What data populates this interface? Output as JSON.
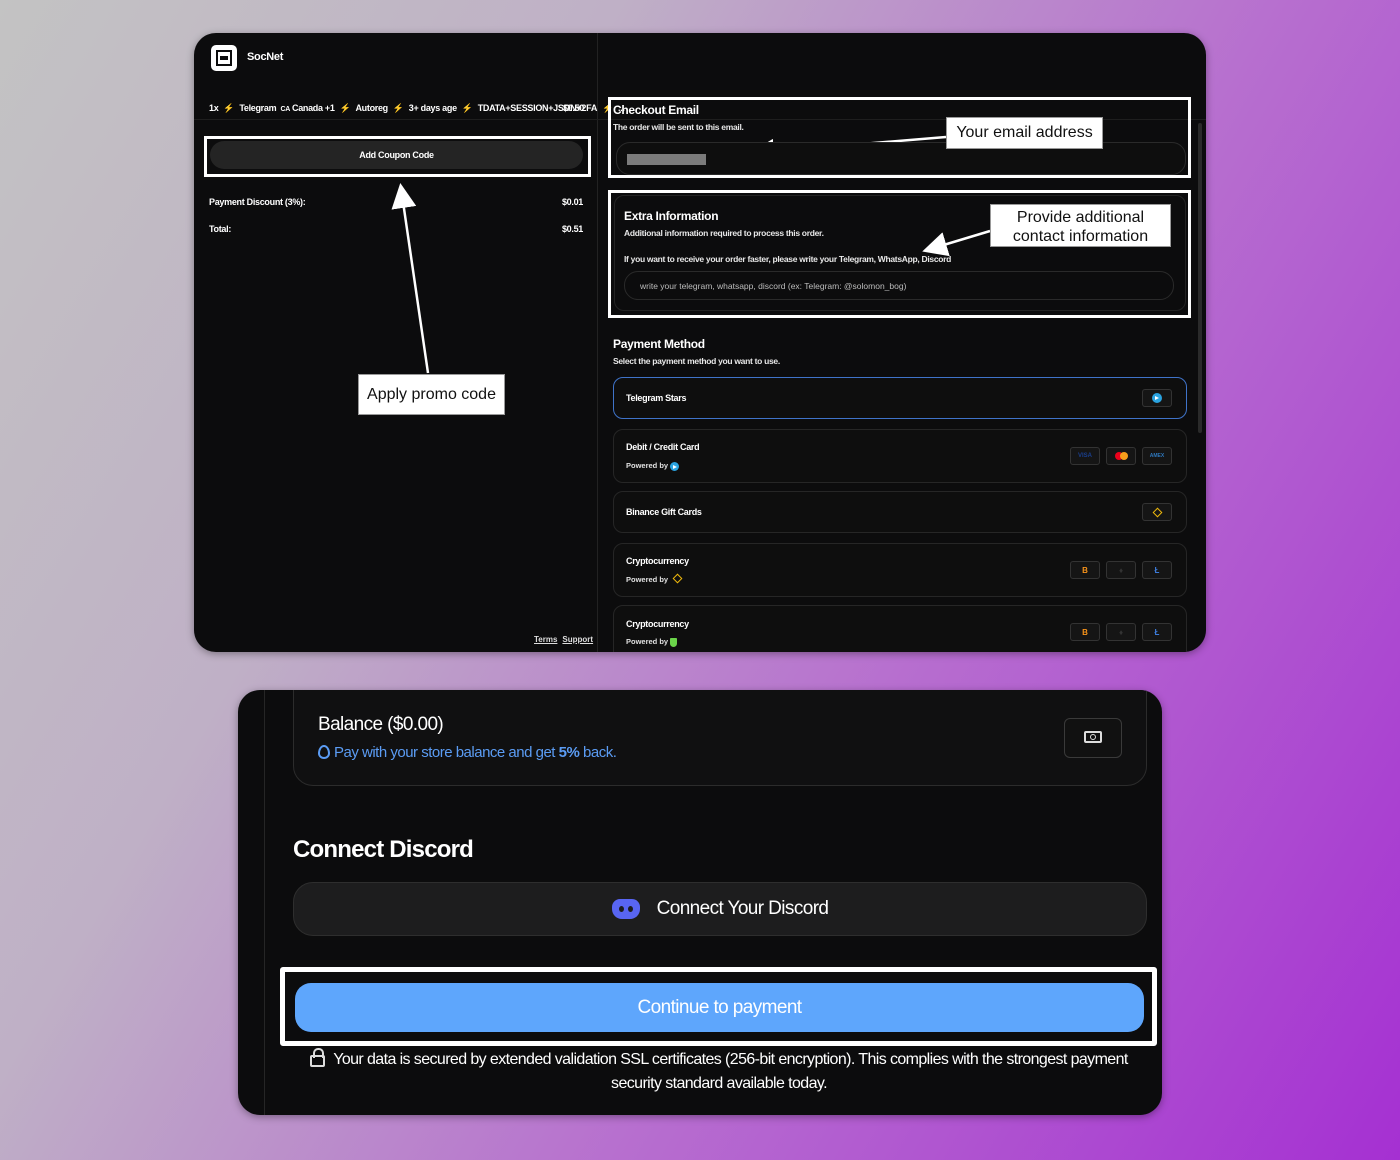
{
  "store": {
    "name": "SocNet"
  },
  "order": {
    "quantity": "1x",
    "segments": [
      "Telegram",
      "Canada +1",
      "Autoreg",
      "3+ days age",
      "TDATA+SESSION+JSON+2FA",
      "..."
    ],
    "country_code": "CA",
    "price": "$0.50"
  },
  "coupon": {
    "label": "Add Coupon Code"
  },
  "summary": {
    "discount_label": "Payment Discount (3%):",
    "discount_value": "$0.01",
    "total_label": "Total:",
    "total_value": "$0.51"
  },
  "footer": {
    "terms": "Terms",
    "support": "Support"
  },
  "annotations": {
    "email": "Your email address",
    "extra_line1": "Provide additional",
    "extra_line2": "contact information",
    "promo": "Apply promo code"
  },
  "checkout_email": {
    "title": "Checkout Email",
    "subtitle": "The order will be sent to this email."
  },
  "extra_info": {
    "title": "Extra Information",
    "subtitle": "Additional information required to process this order.",
    "prompt": "If you want to receive your order faster, please write your Telegram, WhatsApp, Discord",
    "placeholder": "write your telegram, whatsapp, discord (ex: Telegram: @solomon_bog)"
  },
  "payment": {
    "title": "Payment Method",
    "subtitle": "Select the payment method you want to use.",
    "powered_by": "Powered by",
    "methods": [
      {
        "label": "Telegram Stars"
      },
      {
        "label": "Debit / Credit Card",
        "icons": [
          "VISA",
          "mastercard",
          "AMEX"
        ]
      },
      {
        "label": "Binance Gift Cards"
      },
      {
        "label": "Cryptocurrency",
        "icons": [
          "B",
          "♦",
          "Ł"
        ]
      },
      {
        "label": "Cryptocurrency",
        "icons": [
          "B",
          "♦",
          "Ł"
        ]
      }
    ]
  },
  "balance": {
    "title": "Balance ($0.00)",
    "subtitle_pre": "Pay with your store balance and get ",
    "subtitle_bold": "5%",
    "subtitle_post": " back."
  },
  "discord": {
    "title": "Connect Discord",
    "button": "Connect Your Discord"
  },
  "continue": {
    "label": "Continue to payment"
  },
  "security": {
    "text": "Your data is secured by extended validation SSL certificates (256-bit encryption). This complies with the strongest payment security standard available today."
  },
  "colors": {
    "accent_blue": "#5ea6fc",
    "selected_border": "#3f73c9",
    "bolt_orange": "#f36b2c",
    "binance_yellow": "#f0b90b",
    "discord": "#5865f2"
  }
}
